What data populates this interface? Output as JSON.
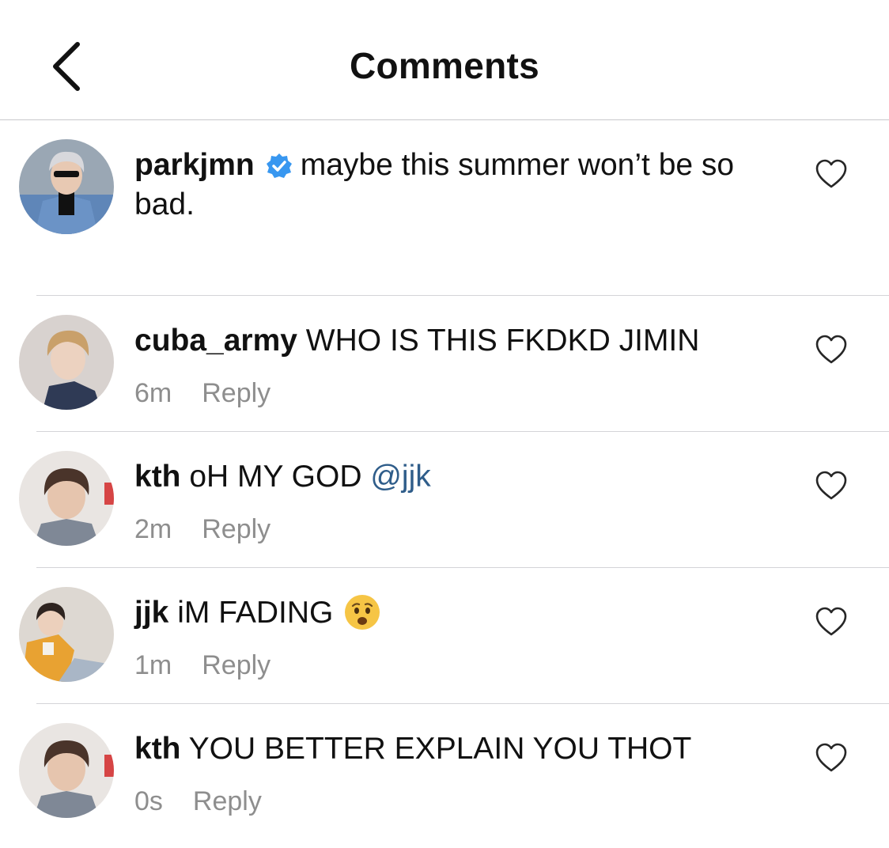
{
  "header": {
    "title": "Comments",
    "back_icon": "chevron-left-icon"
  },
  "caption": {
    "username": "parkjmn",
    "verified_icon": "verified-badge-icon",
    "text": "maybe this summer won’t be so bad."
  },
  "comments": [
    {
      "username": "cuba_army",
      "text": "WHO IS THIS FKDKD JIMIN",
      "time": "6m",
      "reply_label": "Reply"
    },
    {
      "username": "kth",
      "text": "oH MY GOD ",
      "mention": "@jjk",
      "time": "2m",
      "reply_label": "Reply"
    },
    {
      "username": "jjk",
      "text": "iM FADING",
      "emoji": "anxious-face-emoji",
      "time": "1m",
      "reply_label": "Reply"
    },
    {
      "username": "kth",
      "text": "YOU BETTER EXPLAIN YOU THOT",
      "time": "0s",
      "reply_label": "Reply"
    }
  ],
  "colors": {
    "mention": "#2f5d8a",
    "verified": "#3897f0",
    "meta": "#8e8e8e",
    "divider": "#d4d4d8"
  }
}
